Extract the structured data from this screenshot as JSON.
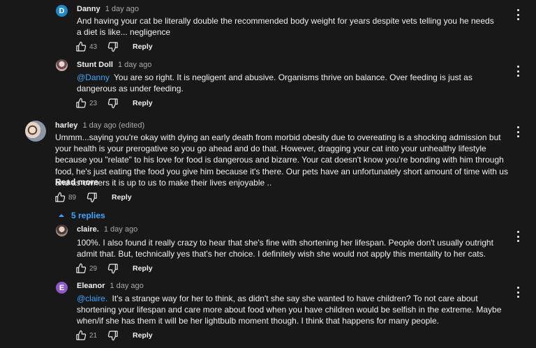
{
  "comments": [
    {
      "author": "Danny",
      "time": "1 day ago",
      "avatar_letter": "D",
      "avatar_color": "#1e88c8",
      "mention": "",
      "text": "And having your cat be literally double the recommended body weight for years despite vets telling you he needs a diet is like... negligence",
      "likes": "43",
      "reply_label": "Reply"
    },
    {
      "author": "Stunt Doll",
      "time": "1 day ago",
      "avatar_letter": "",
      "avatar_color": "#b9a2a8",
      "mention": "@Danny",
      "text": "You are so right. It is negligent and abusive. Organisms thrive on balance. Over feeding is just as dangerous as under feeding.",
      "likes": "23",
      "reply_label": "Reply"
    },
    {
      "author": "harley",
      "time": "1 day ago (edited)",
      "avatar_letter": "",
      "avatar_color": "#c9b9a9",
      "mention": "",
      "text": "Ummm...saying you're okay with dying an early death from morbid obesity due to overeating is a shocking admission but your health is your prerogative so you go ahead and do that. However, dragging your cat into your unhealthy lifestyle because you \"relate\" to his love for food is dangerous and bizarre. Your cat doesn't know you're bonding with him through food, he's just eating the food you give him because it's there. Our pets have an unfortunately short amount of time with us and as owners it is up to us to make their lives enjoyable ..",
      "read_more": "Read more",
      "likes": "89",
      "reply_label": "Reply",
      "replies_label": "5 replies"
    },
    {
      "author": "claire.",
      "time": "1 day ago",
      "avatar_letter": "",
      "avatar_color": "#a89890",
      "mention": "",
      "text": "100%. I also found it really crazy to hear that she's fine with shortening her lifespan. People don't usually outright admit that. But, technically yes that's her choice. I definitely wish she would not apply this mentality to her cats.",
      "likes": "29",
      "reply_label": "Reply"
    },
    {
      "author": "Eleanor",
      "time": "1 day ago",
      "avatar_letter": "E",
      "avatar_color": "#8e57c8",
      "mention": "@claire.",
      "text": "It's a strange way for her to think, as didn't she say she wanted to have children? To not care about shortening your lifespan and care more about food when you have children would be selfish in the extreme. Maybe when/if she has them it will be her lightbulb moment though. I think that happens for many people.",
      "likes": "21",
      "reply_label": "Reply"
    }
  ],
  "icons": {
    "like": "thumbs-up-icon",
    "dislike": "thumbs-down-icon",
    "menu": "more-vertical-icon",
    "expand": "chevron-up-icon"
  }
}
